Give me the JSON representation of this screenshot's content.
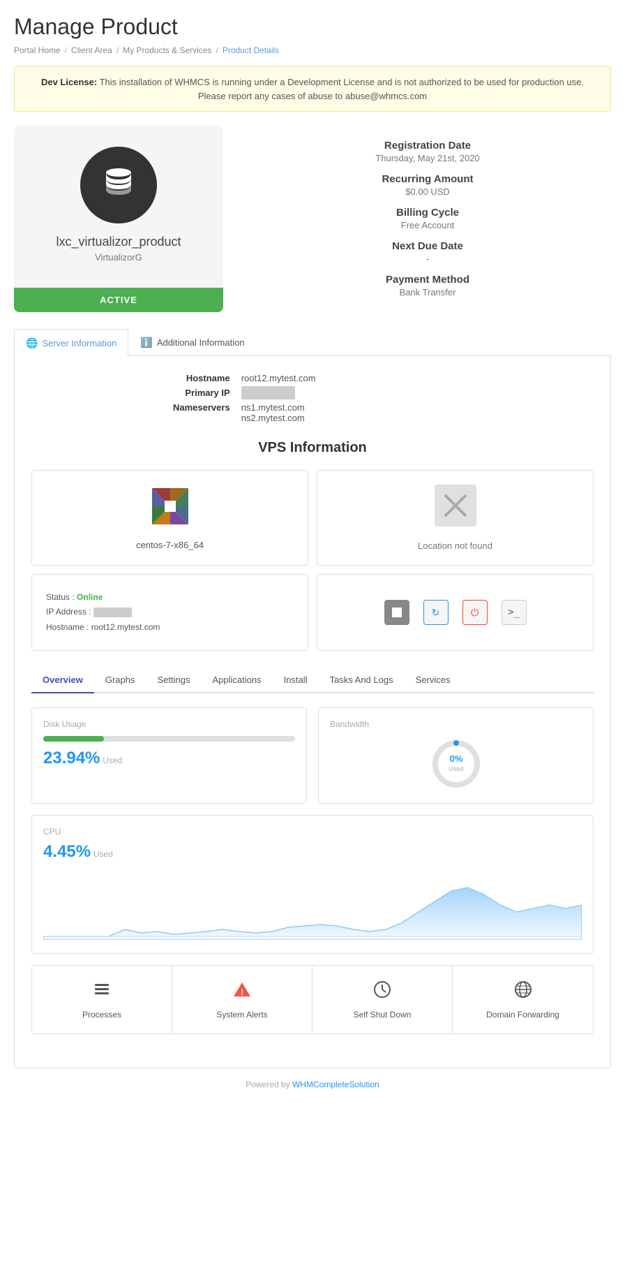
{
  "page": {
    "title": "Manage Product",
    "breadcrumbs": [
      {
        "label": "Portal Home",
        "active": false
      },
      {
        "label": "Client Area",
        "active": false
      },
      {
        "label": "My Products & Services",
        "active": false
      },
      {
        "label": "Product Details",
        "active": true
      }
    ]
  },
  "warning": {
    "prefix": "Dev License:",
    "message": "This installation of WHMCS is running under a Development License and is not authorized to be used for production use. Please report any cases of abuse to abuse@whmcs.com"
  },
  "product": {
    "name": "lxc_virtualizor_product",
    "subtitle": "VirtualizorG",
    "status": "ACTIVE",
    "registration_label": "Registration Date",
    "registration_value": "Thursday, May 21st, 2020",
    "recurring_label": "Recurring Amount",
    "recurring_value": "$0.00 USD",
    "billing_label": "Billing Cycle",
    "billing_value": "Free Account",
    "due_label": "Next Due Date",
    "due_value": "-",
    "payment_label": "Payment Method",
    "payment_value": "Bank Transfer"
  },
  "tabs": {
    "server_info_label": "Server Information",
    "additional_info_label": "Additional Information"
  },
  "server_info": {
    "hostname_label": "Hostname",
    "hostname_value": "root12.mytest.com",
    "primary_ip_label": "Primary IP",
    "primary_ip_value": "██████████",
    "nameservers_label": "Nameservers",
    "ns1_value": "ns1.mytest.com",
    "ns2_value": "ns2.mytest.com"
  },
  "vps": {
    "title": "VPS Information",
    "os_name": "centos-7-x86_64",
    "location_text": "Location not found",
    "status_label": "Status :",
    "status_value": "Online",
    "ip_label": "IP Address :",
    "ip_value": "██████",
    "hostname_label": "Hostname :",
    "hostname_value": "root12.mytest.com"
  },
  "sub_tabs": [
    "Overview",
    "Graphs",
    "Settings",
    "Applications",
    "Install",
    "Tasks And Logs",
    "Services"
  ],
  "disk": {
    "label": "Disk Usage",
    "percent": 23.94,
    "display": "23.94%",
    "used_label": "Used",
    "bar_fill_width": "24%"
  },
  "bandwidth": {
    "label": "Bandwidth",
    "percent": 0,
    "display": "0%",
    "used_label": "Used"
  },
  "cpu": {
    "label": "CPU",
    "percent": 4.45,
    "display": "4.45%",
    "used_label": "Used"
  },
  "actions": [
    {
      "label": "Processes",
      "icon": "layers",
      "color": "dark"
    },
    {
      "label": "System Alerts",
      "icon": "alert",
      "color": "red"
    },
    {
      "label": "Self Shut Down",
      "icon": "clock",
      "color": "dark"
    },
    {
      "label": "Domain Forwarding",
      "icon": "globe",
      "color": "dark"
    }
  ],
  "footer": {
    "text": "Powered by ",
    "link_label": "WHMCompleteSolution",
    "link_url": "#"
  }
}
